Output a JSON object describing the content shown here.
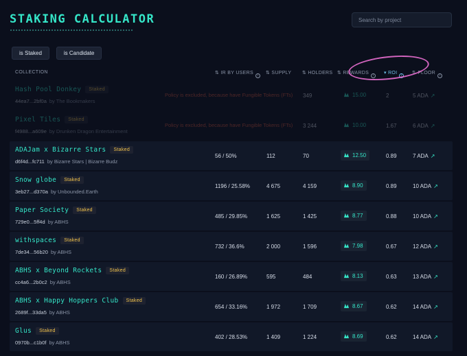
{
  "app": {
    "title": "STAKING CALCULATOR",
    "search_placeholder": "Search by project"
  },
  "filters": [
    "is Staked",
    "is Candidate"
  ],
  "columns": {
    "collection": "COLLECTION",
    "ir": "IR BY USERS",
    "supply": "SUPPLY",
    "holders": "HOLDERS",
    "rewards": "REWARDS",
    "roi": "ROI",
    "floor": "FLOOR"
  },
  "sort": {
    "column": "ROI",
    "direction": "descending"
  },
  "colors": {
    "accent": "#35e6c8",
    "badge": "#f2c34b",
    "warning": "#d6553d",
    "highlight": "#e86ed0"
  },
  "rows": [
    {
      "name": "Hash Pool Donkey",
      "badge": "Staked",
      "policy": "44ea7...2bf0a",
      "by": "by The Bookmakers",
      "warning": "Policy is excluded, because have Fungible Tokens (FTs)",
      "ir": "",
      "supply": "",
      "holders": "349",
      "reward": "15.00",
      "roi": "2",
      "floor": "5 ADA",
      "faded": true
    },
    {
      "name": "Pixel Tiles",
      "badge": "Staked",
      "policy": "f4988...a609e",
      "by": "by Drunken Dragon Entertainment",
      "warning": "Policy is excluded, because have Fungible Tokens (FTs)",
      "ir": "",
      "supply": "",
      "holders": "3 244",
      "reward": "10.00",
      "roi": "1.67",
      "floor": "6 ADA",
      "faded": true
    },
    {
      "name": "ADAJam x Bizarre Stars",
      "badge": "Staked",
      "policy": "d6f4d...fc711",
      "by": "by Bizarre Stars | Bizarre Budz",
      "warning": "",
      "ir": "56 / 50%",
      "supply": "112",
      "holders": "70",
      "reward": "12.50",
      "roi": "0.89",
      "floor": "7 ADA",
      "faded": false
    },
    {
      "name": "Snow globe",
      "badge": "Staked",
      "policy": "3eb27...d370a",
      "by": "by Unbounded.Earth",
      "warning": "",
      "ir": "1196 / 25.58%",
      "supply": "4 675",
      "holders": "4 159",
      "reward": "8.90",
      "roi": "0.89",
      "floor": "10 ADA",
      "faded": false
    },
    {
      "name": "Paper Society",
      "badge": "Staked",
      "policy": "729e0...5ff4d",
      "by": "by ABHS",
      "warning": "",
      "ir": "485 / 29.85%",
      "supply": "1 625",
      "holders": "1 425",
      "reward": "8.77",
      "roi": "0.88",
      "floor": "10 ADA",
      "faded": false
    },
    {
      "name": "withspaces",
      "badge": "Staked",
      "policy": "7de34...56b20",
      "by": "by ABHS",
      "warning": "",
      "ir": "732 / 36.6%",
      "supply": "2 000",
      "holders": "1 596",
      "reward": "7.98",
      "roi": "0.67",
      "floor": "12 ADA",
      "faded": false
    },
    {
      "name": "ABHS x Beyond Rockets",
      "badge": "Staked",
      "policy": "cc4a6...2b0c2",
      "by": "by ABHS",
      "warning": "",
      "ir": "160 / 26.89%",
      "supply": "595",
      "holders": "484",
      "reward": "8.13",
      "roi": "0.63",
      "floor": "13 ADA",
      "faded": false
    },
    {
      "name": "ABHS x Happy Hoppers Club",
      "badge": "Staked",
      "policy": "2689f...33da5",
      "by": "by ABHS",
      "warning": "",
      "ir": "654 / 33.16%",
      "supply": "1 972",
      "holders": "1 709",
      "reward": "8.67",
      "roi": "0.62",
      "floor": "14 ADA",
      "faded": false
    },
    {
      "name": "Glus",
      "badge": "Staked",
      "policy": "0970b...c1b0f",
      "by": "by ABHS",
      "warning": "",
      "ir": "402 / 28.53%",
      "supply": "1 409",
      "holders": "1 224",
      "reward": "8.69",
      "roi": "0.62",
      "floor": "14 ADA",
      "faded": false
    }
  ]
}
